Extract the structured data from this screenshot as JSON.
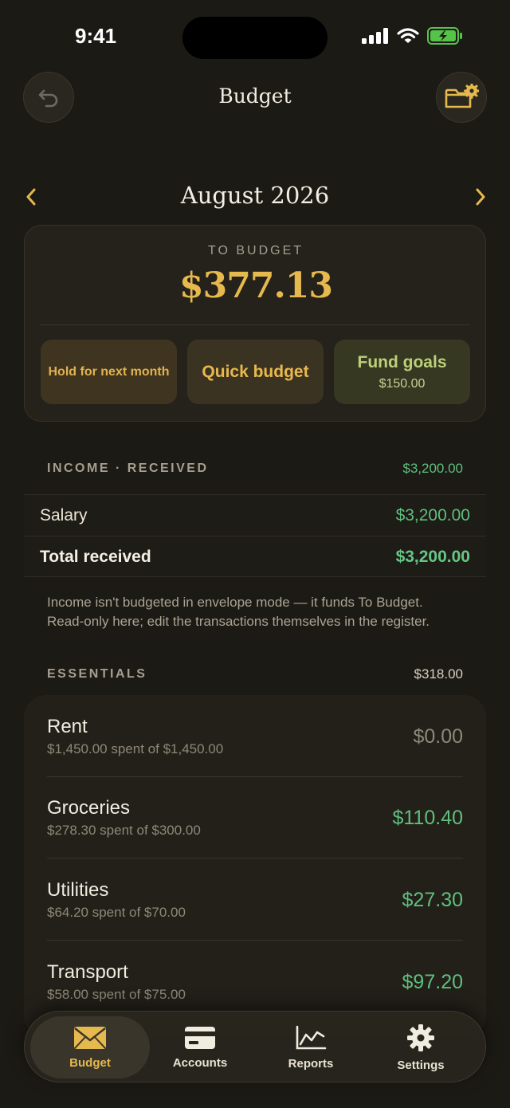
{
  "status_bar": {
    "time": "9:41"
  },
  "header": {
    "title": "Budget",
    "back_icon": "undo-icon",
    "folder_icon": "folder-settings-icon"
  },
  "month": {
    "label": "August 2026",
    "prev_icon": "chevron-left-icon",
    "next_icon": "chevron-right-icon"
  },
  "to_budget": {
    "label": "TO BUDGET",
    "amount": "$377.13",
    "hold_label": "Hold for next month",
    "quick_label": "Quick budget",
    "fund_label": "Fund goals",
    "fund_amount": "$150.00"
  },
  "income": {
    "title": "INCOME · RECEIVED",
    "total": "$3,200.00",
    "rows": [
      {
        "label": "Salary",
        "amount": "$3,200.00"
      },
      {
        "label": "Total received",
        "amount": "$3,200.00"
      }
    ],
    "note": "Income isn't budgeted in envelope mode — it funds To Budget. Read-only here; edit the transactions themselves in the register."
  },
  "essentials": {
    "title": "ESSENTIALS",
    "total": "$318.00",
    "categories": [
      {
        "name": "Rent",
        "sub": "$1,450.00 spent of $1,450.00",
        "available": "$0.00"
      },
      {
        "name": "Groceries",
        "sub": "$278.30 spent of $300.00",
        "available": "$110.40"
      },
      {
        "name": "Utilities",
        "sub": "$64.20 spent of $70.00",
        "available": "$27.30"
      },
      {
        "name": "Transport",
        "sub": "$58.00 spent of $75.00",
        "available": "$97.20"
      }
    ]
  },
  "tabs": [
    {
      "label": "Budget",
      "icon": "envelope-icon",
      "active": true
    },
    {
      "label": "Accounts",
      "icon": "credit-card-icon",
      "active": false
    },
    {
      "label": "Reports",
      "icon": "chart-line-icon",
      "active": false
    },
    {
      "label": "Settings",
      "icon": "gear-icon",
      "active": false
    }
  ],
  "colors": {
    "background": "#1c1a15",
    "accent_gold": "#e6b94f",
    "positive_green": "#5fbf7d"
  }
}
